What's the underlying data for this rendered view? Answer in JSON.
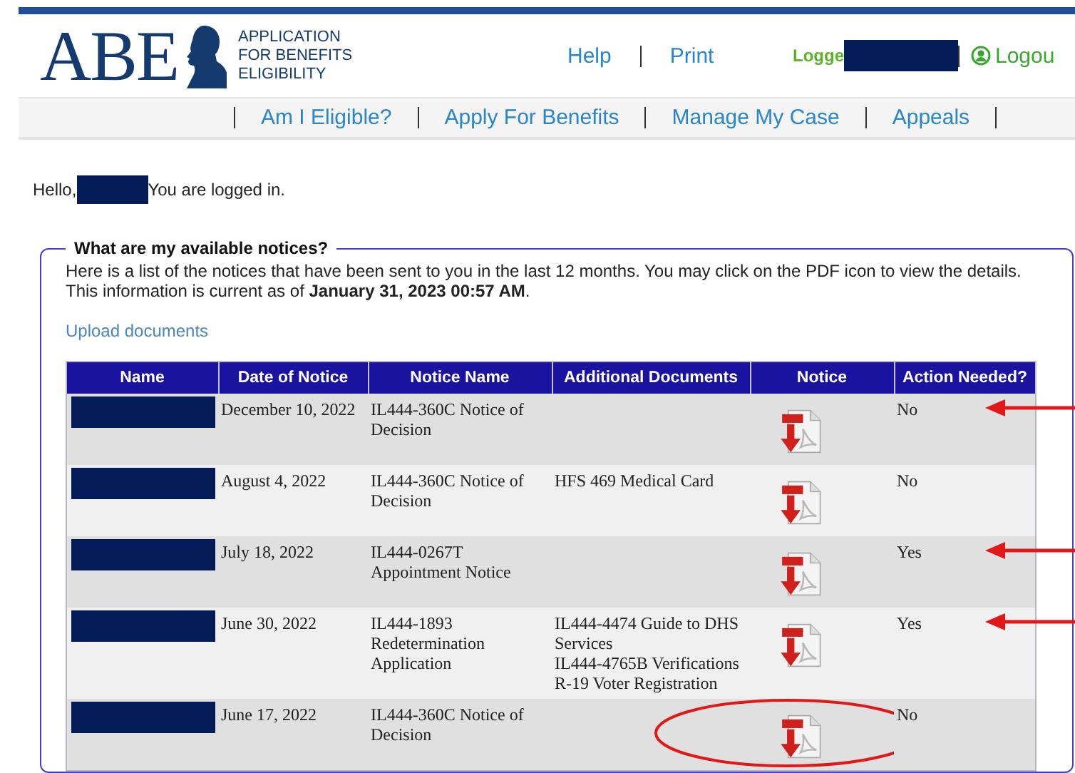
{
  "logo": {
    "wordmark": "ABE",
    "tagline": [
      "APPLICATION",
      "FOR BENEFITS",
      "ELIGIBILITY"
    ]
  },
  "header_links": [
    "Help",
    "Print"
  ],
  "account": {
    "logged_label": "Logge",
    "logout": "Logou"
  },
  "nav": [
    "Am I Eligible?",
    "Apply For Benefits",
    "Manage My Case",
    "Appeals"
  ],
  "greeting": {
    "before": "Hello,",
    "after": "You are logged in."
  },
  "notices": {
    "legend": "What are my available notices?",
    "intro": "Here is a list of the notices that have been sent to you in the last 12 months. You may click on the PDF icon to view the details. This information is current as of **January 31, 2023 00:57 AM**.",
    "upload_link": "Upload documents",
    "columns": [
      "Name",
      "Date of Notice",
      "Notice Name",
      "Additional Documents",
      "Notice",
      "Action Needed?"
    ],
    "rows": [
      {
        "date": "December 10, 2022",
        "notice_name": "IL444-360C Notice of Decision",
        "additional_documents": [],
        "action_needed": "No",
        "arrow": true,
        "circled": false
      },
      {
        "date": "August 4, 2022",
        "notice_name": "IL444-360C Notice of Decision",
        "additional_documents": [
          "HFS 469 Medical Card"
        ],
        "action_needed": "No",
        "arrow": false,
        "circled": false
      },
      {
        "date": "July 18, 2022",
        "notice_name": "IL444-0267T Appointment Notice",
        "additional_documents": [],
        "action_needed": "Yes",
        "arrow": true,
        "circled": false
      },
      {
        "date": "June 30, 2022",
        "notice_name": "IL444-1893 Redetermination Application",
        "additional_documents": [
          "IL444-4474 Guide to DHS Services",
          "IL444-4765B Verifications",
          "R-19 Voter Registration"
        ],
        "action_needed": "Yes",
        "arrow": true,
        "circled": false
      },
      {
        "date": "June 17, 2022",
        "notice_name": "IL444-360C Notice of Decision",
        "additional_documents": [],
        "action_needed": "No",
        "arrow": false,
        "circled": true
      }
    ]
  }
}
